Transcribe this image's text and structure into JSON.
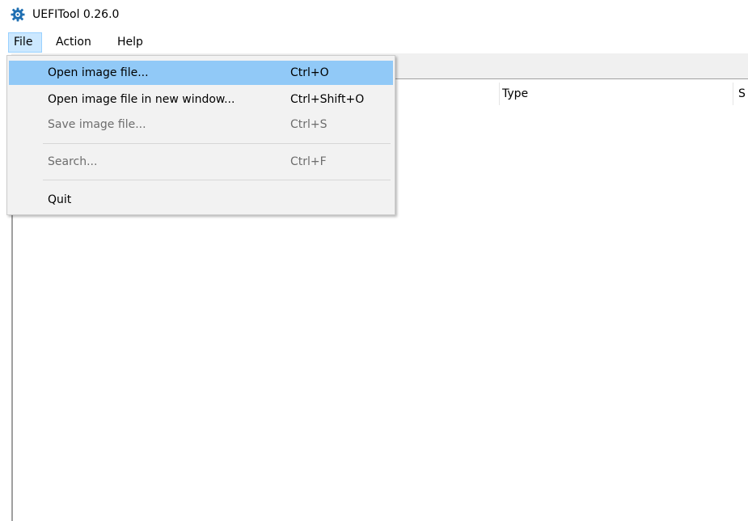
{
  "window": {
    "title": "UEFITool 0.26.0",
    "icon": "gear-icon",
    "icon_color": "#1f6fb2"
  },
  "menubar": {
    "items": [
      {
        "label": "File",
        "active": true
      },
      {
        "label": "Action"
      },
      {
        "label": "Help"
      }
    ]
  },
  "file_menu": {
    "items": [
      {
        "label": "Open image file...",
        "shortcut": "Ctrl+O",
        "enabled": true,
        "highlighted": true
      },
      {
        "label": "Open image file in new window...",
        "shortcut": "Ctrl+Shift+O",
        "enabled": true
      },
      {
        "label": "Save image file...",
        "shortcut": "Ctrl+S",
        "enabled": false
      },
      {
        "label": "Search...",
        "shortcut": "Ctrl+F",
        "enabled": false
      },
      {
        "label": "Quit",
        "shortcut": "",
        "enabled": true
      }
    ]
  },
  "structure_tree": {
    "columns": [
      "Type",
      "S"
    ]
  },
  "colors": {
    "highlight": "#91c9f7",
    "menu_background": "#f2f2f2",
    "active_menu_background": "#cce8ff",
    "disabled_text": "#6d6d6d"
  }
}
